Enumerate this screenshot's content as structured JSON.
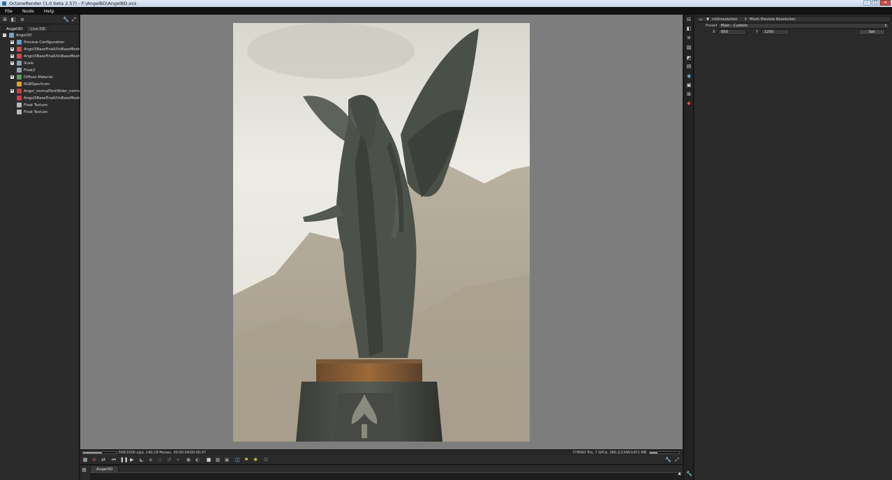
{
  "window": {
    "title": "OctaneRender (1.0 beta 2.57) - F:\\AngelBD\\AngelBD.ocs",
    "minimize": "–",
    "maximize": "□",
    "close": "✕"
  },
  "menu": [
    "File",
    "Node",
    "Help"
  ],
  "left_panel": {
    "tabs": [
      "Angel3D",
      "Live DB"
    ],
    "tree": [
      {
        "label": "Angel3D",
        "level": 0,
        "expand": "–",
        "icon_color": "#7f9fbf",
        "icon": "scene-icon"
      },
      {
        "label": "Preview Configuration",
        "level": 1,
        "expand": "+",
        "icon_color": "#6aa0c8",
        "icon": "config-icon"
      },
      {
        "label": "Angel3BaseFinalUVsBaseMesh_1",
        "level": 1,
        "expand": "+",
        "icon_color": "#d04a4a",
        "icon": "mesh-icon"
      },
      {
        "label": "Angel3BaseFinalUVsBaseMesh_1",
        "level": 1,
        "expand": "+",
        "icon_color": "#d04a4a",
        "icon": "mesh-icon"
      },
      {
        "label": "Scale",
        "level": 1,
        "expand": "+",
        "icon_color": "#8aa0b8",
        "icon": "transform-icon"
      },
      {
        "label": "Float2",
        "level": 1,
        "expand": "",
        "icon_color": "#9aa4b0",
        "icon": "float-icon"
      },
      {
        "label": "Diffuse Material",
        "level": 1,
        "expand": "+",
        "icon_color": "#5a9a5a",
        "icon": "material-icon"
      },
      {
        "label": "RGBSpectrum",
        "level": 1,
        "expand": "",
        "icon_color": "#e0a030",
        "icon": "rgb-icon"
      },
      {
        "label": "Angel_normalTextWider_normals",
        "level": 1,
        "expand": "+",
        "icon_color": "#c84040",
        "icon": "mesh-icon"
      },
      {
        "label": "Angel3BaseFinalUVsBaseMesh_1",
        "level": 1,
        "expand": "",
        "icon_color": "#c84040",
        "icon": "mesh-icon"
      },
      {
        "label": "Float Texture",
        "level": 1,
        "expand": "",
        "icon_color": "#b8b8b8",
        "icon": "texture-icon"
      },
      {
        "label": "Float Texture",
        "level": 1,
        "expand": "",
        "icon_color": "#b8b8b8",
        "icon": "texture-icon"
      }
    ]
  },
  "status": {
    "left_text": "556/1000 s/px, 140.18 Ms/sec, 00:00:04/00:00:07",
    "right_text": "778560 Tris, 7 GPUs, 380.2/1346/1471 MB",
    "left_progress": 0.556,
    "right_progress": 0.26
  },
  "bottom": {
    "tab": "Angel3D",
    "scroll_up": "▲"
  },
  "inspector": {
    "node_type": "int2resolution",
    "node_name": "Mesh Preview Resolution",
    "preset_label": "Preset",
    "preset_value": "Main - Custom",
    "x_label": "X",
    "x_value": "850",
    "y_label": "Y",
    "y_value": "1200",
    "set_label": "Set"
  },
  "icons": {
    "caret": "⇕",
    "play": "▶",
    "pause": "❚❚",
    "rewind": "⏮",
    "wrench": "🔧",
    "fullscreen": "⤢"
  }
}
